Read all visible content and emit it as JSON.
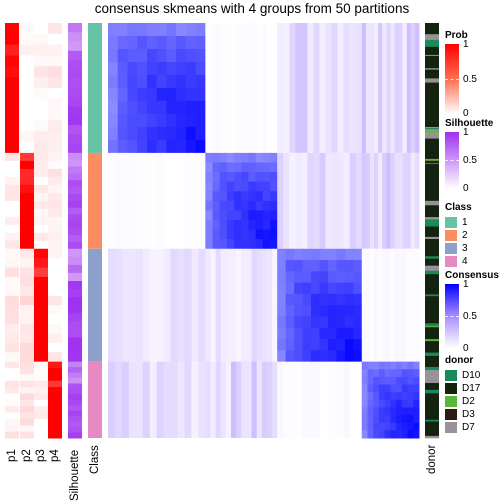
{
  "title": "consensus skmeans with 4 groups from 50 partitions",
  "chart_data": {
    "type": "heatmap",
    "title": "consensus skmeans with 4 groups from 50 partitions",
    "classes": [
      1,
      2,
      3,
      4
    ],
    "class_row_fraction": [
      0.313,
      0.231,
      0.272,
      0.184
    ],
    "consensus_blocks": [
      [
        0.85,
        0.02,
        0.25,
        0.3
      ],
      [
        0.02,
        0.8,
        0.2,
        0.25
      ],
      [
        0.15,
        0.15,
        0.85,
        0.03
      ],
      [
        0.2,
        0.25,
        0.03,
        0.85
      ]
    ],
    "probability_columns": [
      "p1",
      "p2",
      "p3",
      "p4"
    ],
    "mean_probability_by_class": [
      [
        0.92,
        0.02,
        0.05,
        0.06
      ],
      [
        0.03,
        0.88,
        0.04,
        0.08
      ],
      [
        0.08,
        0.1,
        0.9,
        0.03
      ],
      [
        0.06,
        0.08,
        0.02,
        0.92
      ]
    ],
    "silhouette_by_class": [
      0.82,
      0.78,
      0.85,
      0.8
    ],
    "annotation_labels": [
      "p1",
      "p2",
      "p3",
      "p4",
      "Silhouette",
      "Class",
      "donor"
    ]
  },
  "legends": {
    "prob": {
      "title": "Prob",
      "ticks": [
        "1",
        "0.5",
        "0"
      ],
      "color": "#ff0000"
    },
    "silhouette": {
      "title": "Silhouette",
      "ticks": [
        "1",
        "0.5",
        "0"
      ],
      "color": "#9f30f0"
    },
    "class": {
      "title": "Class",
      "items": [
        {
          "label": "1",
          "color": "#66c2a5"
        },
        {
          "label": "2",
          "color": "#fc8d62"
        },
        {
          "label": "3",
          "color": "#8da0cb"
        },
        {
          "label": "4",
          "color": "#e78ac3"
        }
      ]
    },
    "consensus": {
      "title": "Consensus",
      "ticks": [
        "1",
        "0.5",
        "0"
      ],
      "color": "#0000ff"
    },
    "donor": {
      "title": "donor",
      "items": [
        {
          "label": "D10",
          "color": "#1b8a5a"
        },
        {
          "label": "D17",
          "color": "#13230f"
        },
        {
          "label": "D2",
          "color": "#5cb83a"
        },
        {
          "label": "D3",
          "color": "#2e1a15"
        },
        {
          "label": "D7",
          "color": "#999399"
        }
      ]
    }
  }
}
